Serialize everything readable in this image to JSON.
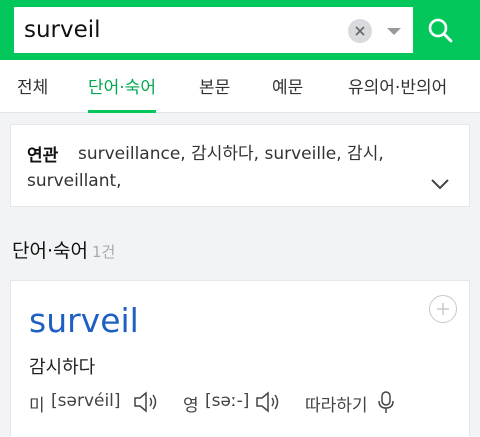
{
  "search": {
    "query": "surveil",
    "placeholder": ""
  },
  "tabs": [
    {
      "label": "전체",
      "active": false
    },
    {
      "label": "단어·숙어",
      "active": true
    },
    {
      "label": "본문",
      "active": false
    },
    {
      "label": "예문",
      "active": false
    },
    {
      "label": "유의어·반의어",
      "active": false
    }
  ],
  "related": {
    "label": "연관",
    "terms": "surveillance, 감시하다, surveille, 감시, surveillant,"
  },
  "section": {
    "title": "단어·숙어",
    "count": "1건"
  },
  "entry": {
    "headword": "surveil",
    "meaning": "감시하다",
    "pron_us_label": "미",
    "pron_us": "[sərvéil]",
    "pron_uk_label": "영",
    "pron_uk": "[səː-]",
    "follow_along": "따라하기"
  },
  "colors": {
    "brand": "#03c75a",
    "headword": "#1d5fc2"
  },
  "icons": [
    "clear-icon",
    "dropdown-arrow-icon",
    "search-icon",
    "chevron-down-icon",
    "plus-icon",
    "speaker-icon",
    "microphone-icon"
  ]
}
